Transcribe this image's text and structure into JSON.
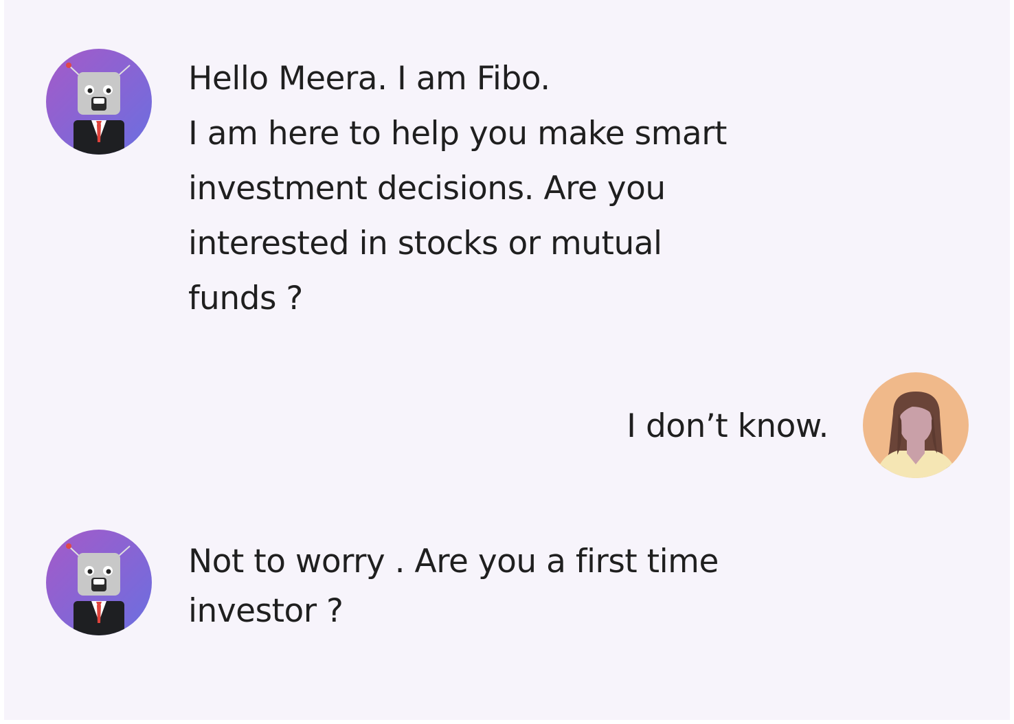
{
  "messages": [
    {
      "sender": "bot",
      "avatar_icon": "robot-advisor-icon",
      "lines": [
        "Hello Meera. I am Fibo.",
        "I am here to help you make smart",
        "investment decisions. Are you",
        "interested in stocks or mutual",
        "funds ?"
      ]
    },
    {
      "sender": "user",
      "avatar_icon": "user-woman-icon",
      "text": "I don’t know."
    },
    {
      "sender": "bot",
      "avatar_icon": "robot-advisor-icon",
      "lines": [
        "Not to worry . Are you a first time",
        "investor ?"
      ]
    }
  ],
  "colors": {
    "background": "#f7f4fb",
    "bot_avatar_gradient": [
      "#9b59c9",
      "#6c6fe0"
    ],
    "user_avatar_bg": "#f0b98a",
    "text": "#1f1f1f"
  }
}
